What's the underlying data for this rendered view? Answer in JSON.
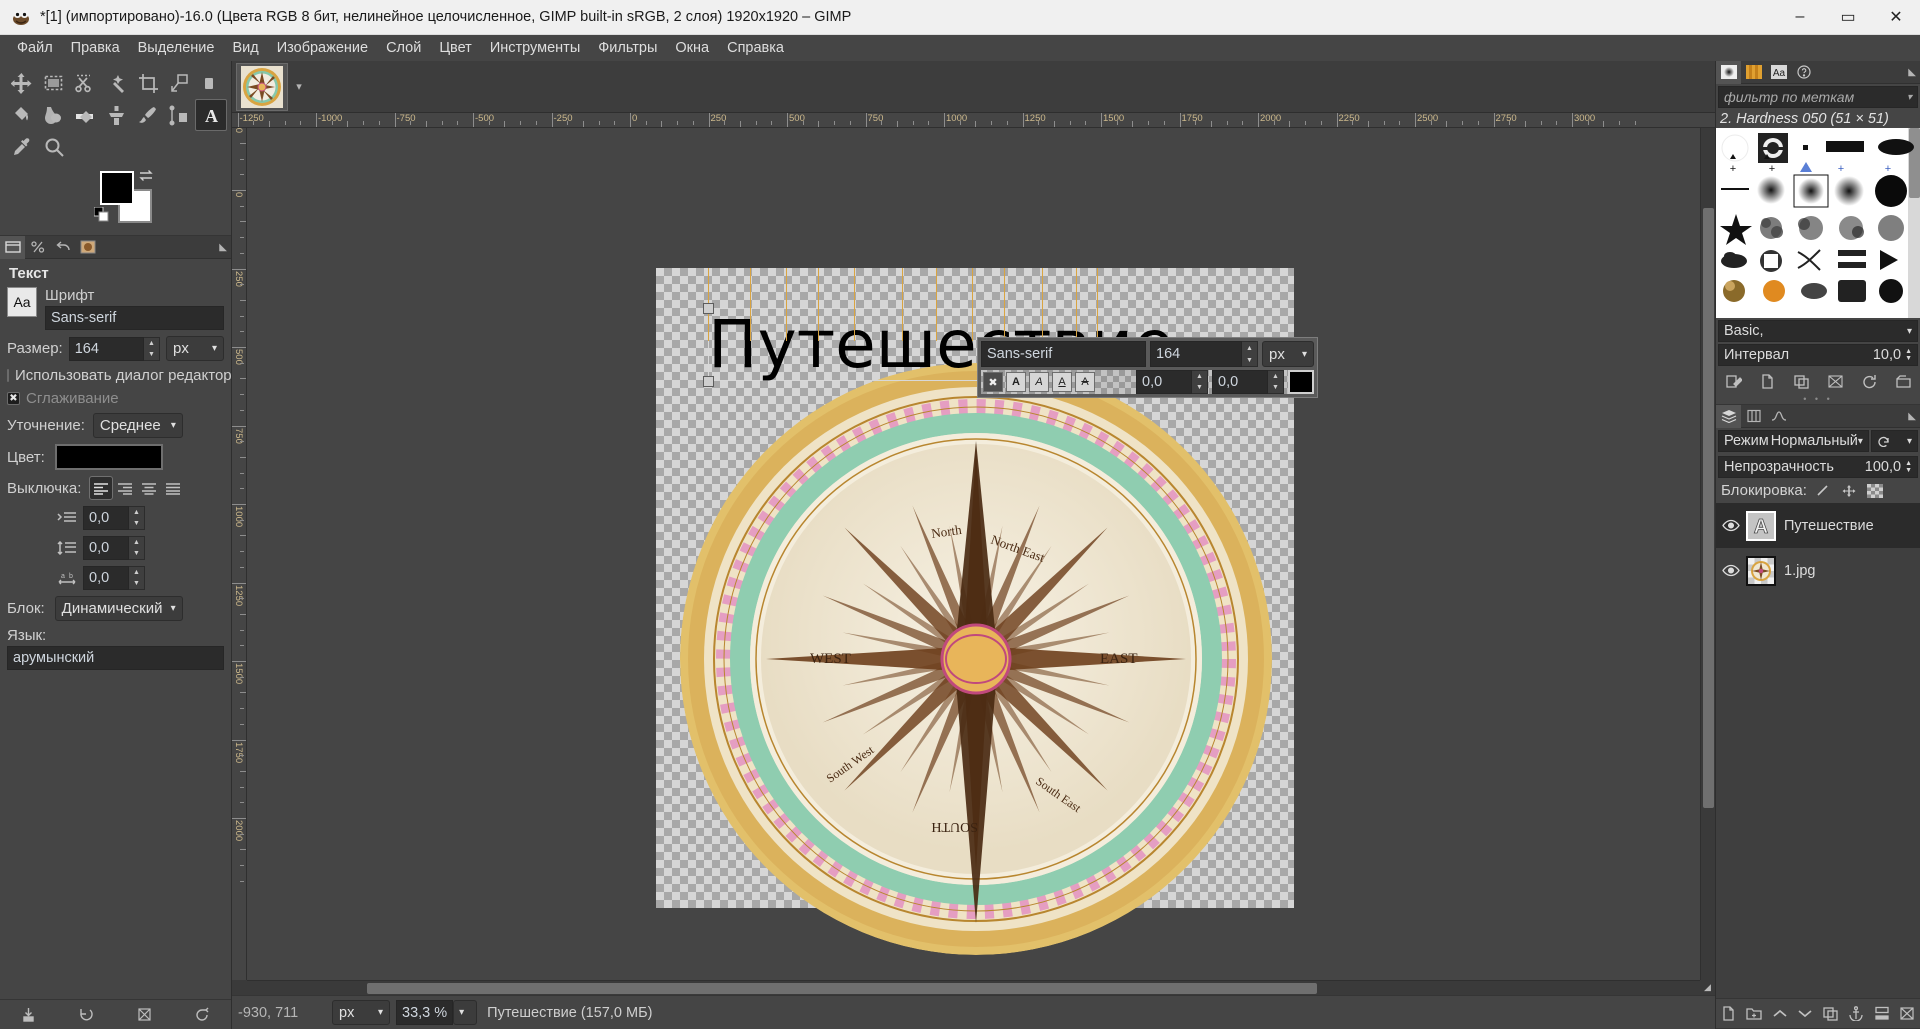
{
  "window": {
    "title": "*[1] (импортировано)-16.0 (Цвета RGB 8 бит, нелинейное целочисленное, GIMP built-in sRGB, 2 слоя) 1920x1920 – GIMP",
    "app_icon": "gimp-wilber-icon",
    "minimize": "–",
    "maximize": "▭",
    "close": "✕"
  },
  "menubar": {
    "items": [
      {
        "label": "Файл",
        "name": "menu-file"
      },
      {
        "label": "Правка",
        "name": "menu-edit"
      },
      {
        "label": "Выделение",
        "name": "menu-select"
      },
      {
        "label": "Вид",
        "name": "menu-view"
      },
      {
        "label": "Изображение",
        "name": "menu-image"
      },
      {
        "label": "Слой",
        "name": "menu-layer"
      },
      {
        "label": "Цвет",
        "name": "menu-color"
      },
      {
        "label": "Инструменты",
        "name": "menu-tools"
      },
      {
        "label": "Фильтры",
        "name": "menu-filters"
      },
      {
        "label": "Окна",
        "name": "menu-windows"
      },
      {
        "label": "Справка",
        "name": "menu-help"
      }
    ]
  },
  "toolbox": {
    "tools": [
      "move-tool",
      "rectangle-select-tool",
      "scissors-select-tool",
      "fuzzy-select-tool",
      "crop-tool",
      "unified-transform-tool",
      "warp-transform-tool",
      "bucket-fill-tool",
      "smudge-tool",
      "eraser-tool",
      "clone-tool",
      "paintbrush-tool",
      "path-tool",
      "text-tool",
      "color-picker-tool",
      "zoom-tool"
    ],
    "selected_tool": "text-tool",
    "foreground_color": "#000000",
    "background_color": "#ffffff",
    "swap_icon": "swap-colors-icon",
    "default_icon": "default-colors-icon"
  },
  "tool_options": {
    "dock_tabs": [
      "tool-options-tab",
      "device-status-tab",
      "undo-history-tab",
      "image-thumb-tab"
    ],
    "title": "Текст",
    "font_label": "Шрифт",
    "font_value": "Sans-serif",
    "font_preview_glyph": "Aa",
    "size_label": "Размер:",
    "size_value": "164",
    "size_unit": "px",
    "use_editor_label": "Использовать диалог редактора",
    "use_editor_checked": false,
    "antialias_label": "Сглаживание",
    "antialias_checked": true,
    "hinting_label": "Уточнение:",
    "hinting_value": "Среднее",
    "color_label": "Цвет:",
    "color_value": "#000000",
    "justify_label": "Выключка:",
    "justify_selected": "left",
    "indent_value": "0,0",
    "line_spacing_value": "0,0",
    "letter_spacing_value": "0,0",
    "box_label": "Блок:",
    "box_value": "Динамический",
    "language_label": "Язык:",
    "language_value": "арумынский",
    "footer_icons": [
      "save-tool-preset-icon",
      "restore-tool-preset-icon",
      "delete-tool-preset-icon",
      "reset-tool-options-icon"
    ]
  },
  "canvas": {
    "image_tab_name": "image-thumbnail-tab",
    "tab_arrow": "▾",
    "text_layer_content": "Путешествие",
    "ruler_h_labels": [
      "-1250",
      "-1000",
      "-750",
      "-500",
      "-250",
      "0",
      "250",
      "500",
      "750",
      "1000",
      "1250",
      "1500",
      "1750",
      "2000",
      "2250",
      "2500",
      "2750",
      "3000"
    ],
    "ruler_v_labels": [
      "-250",
      "0",
      "250",
      "500",
      "750",
      "1000",
      "1250",
      "1500",
      "1750",
      "2000"
    ]
  },
  "on_canvas_toolbar": {
    "font": "Sans-serif",
    "size": "164",
    "unit": "px",
    "clear_style_icon": "clear-style-icon",
    "bold_icon": "bold-icon",
    "italic_icon": "italic-icon",
    "underline_icon": "underline-icon",
    "strikethrough_icon": "strikethrough-icon",
    "baseline_value": "0,0",
    "kerning_value": "0,0",
    "color_value": "#000000"
  },
  "statusbar": {
    "position": "-930, 711",
    "unit": "px",
    "zoom": "33,3 %",
    "message": "Путешествие (157,0 МБ)"
  },
  "brushes_panel": {
    "tabs": [
      "brushes-tab",
      "patterns-tab",
      "fonts-tab",
      "help-tab"
    ],
    "tab_arrow": "◄",
    "tag_filter_placeholder": "фильтр по меткам",
    "selected_brush": "2. Hardness 050 (51 × 51)",
    "preset_value": "Basic,",
    "spacing_label": "Интервал",
    "spacing_value": "10,0",
    "footer_icons": [
      "edit-brush-icon",
      "new-brush-icon",
      "duplicate-brush-icon",
      "delete-brush-icon",
      "refresh-brushes-icon",
      "open-brush-as-image-icon"
    ]
  },
  "layers_panel": {
    "tabs": [
      "layers-tab",
      "channels-tab",
      "paths-tab"
    ],
    "tab_arrow": "◄",
    "mode_label": "Режим",
    "mode_value": "Нормальный",
    "opacity_label": "Непрозрачность",
    "opacity_value": "100,0",
    "lock_label": "Блокировка:",
    "lock_icons": [
      "lock-pixels-icon",
      "lock-position-icon",
      "lock-alpha-icon"
    ],
    "layers": [
      {
        "name": "Путешествие",
        "thumb": "text-layer-icon",
        "visible": true,
        "selected": true
      },
      {
        "name": "1.jpg",
        "thumb": "compass-image-icon",
        "visible": true,
        "selected": false
      }
    ],
    "footer_icons": [
      "new-layer-icon",
      "new-layer-group-icon",
      "raise-layer-icon",
      "lower-layer-icon",
      "duplicate-layer-icon",
      "anchor-layer-icon",
      "merge-down-icon",
      "delete-layer-icon"
    ]
  }
}
